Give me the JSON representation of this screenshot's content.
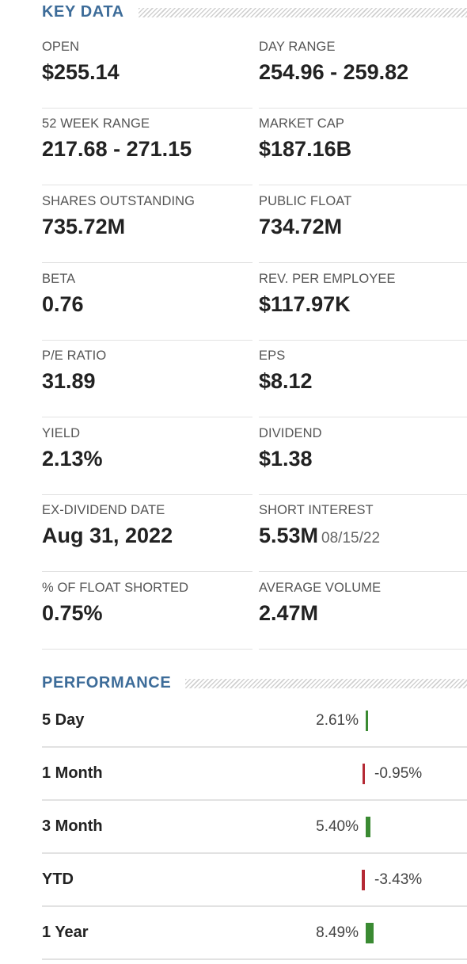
{
  "key_data": {
    "title": "KEY DATA",
    "items": [
      {
        "label": "OPEN",
        "value": "$255.14"
      },
      {
        "label": "DAY RANGE",
        "value": "254.96 - 259.82"
      },
      {
        "label": "52 WEEK RANGE",
        "value": "217.68 - 271.15"
      },
      {
        "label": "MARKET CAP",
        "value": "$187.16B"
      },
      {
        "label": "SHARES OUTSTANDING",
        "value": "735.72M"
      },
      {
        "label": "PUBLIC FLOAT",
        "value": "734.72M"
      },
      {
        "label": "BETA",
        "value": "0.76"
      },
      {
        "label": "REV. PER EMPLOYEE",
        "value": "$117.97K"
      },
      {
        "label": "P/E RATIO",
        "value": "31.89"
      },
      {
        "label": "EPS",
        "value": "$8.12"
      },
      {
        "label": "YIELD",
        "value": "2.13%"
      },
      {
        "label": "DIVIDEND",
        "value": "$1.38"
      },
      {
        "label": "EX-DIVIDEND DATE",
        "value": "Aug 31, 2022"
      },
      {
        "label": "SHORT INTEREST",
        "value": "5.53M",
        "sub": "08/15/22"
      },
      {
        "label": "% OF FLOAT SHORTED",
        "value": "0.75%"
      },
      {
        "label": "AVERAGE VOLUME",
        "value": "2.47M"
      }
    ]
  },
  "performance": {
    "title": "PERFORMANCE",
    "colors": {
      "positive": "#3a8a32",
      "negative": "#b52a35"
    },
    "rows": [
      {
        "label": "5 Day",
        "value": "2.61%",
        "pct": 2.61
      },
      {
        "label": "1 Month",
        "value": "-0.95%",
        "pct": -0.95
      },
      {
        "label": "3 Month",
        "value": "5.40%",
        "pct": 5.4
      },
      {
        "label": "YTD",
        "value": "-3.43%",
        "pct": -3.43
      },
      {
        "label": "1 Year",
        "value": "8.49%",
        "pct": 8.49
      }
    ]
  }
}
